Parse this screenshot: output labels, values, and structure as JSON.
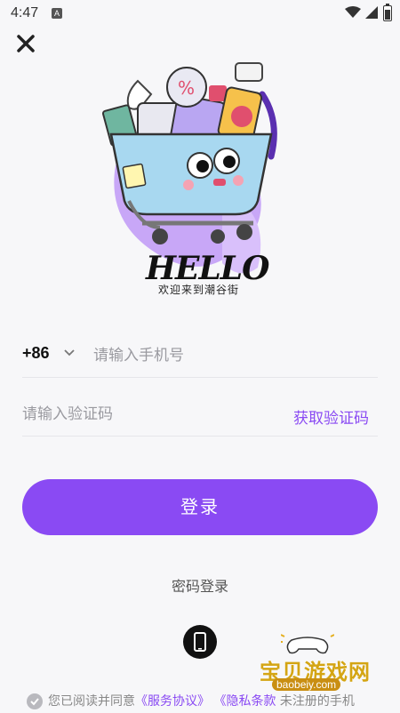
{
  "status_bar": {
    "time": "4:47",
    "notification_icon": "a-icon"
  },
  "hero": {
    "hello_text": "HELLO",
    "welcome": "欢迎来到潮谷街"
  },
  "phone": {
    "country_code": "+86",
    "placeholder": "请输入手机号"
  },
  "code": {
    "placeholder": "请输入验证码",
    "get_code_label": "获取验证码"
  },
  "login": {
    "label": "登录"
  },
  "password_login": {
    "label": "密码登录"
  },
  "agreement": {
    "prefix": "您已阅读并同意",
    "service_link": "《服务协议》",
    "privacy_link": "《隐私条款",
    "suffix": "未注册的手机"
  },
  "watermark": {
    "title": "宝贝游戏网",
    "url": "baobeiy.com"
  },
  "colors": {
    "accent": "#8a4af3",
    "background": "#f7f7f9"
  }
}
